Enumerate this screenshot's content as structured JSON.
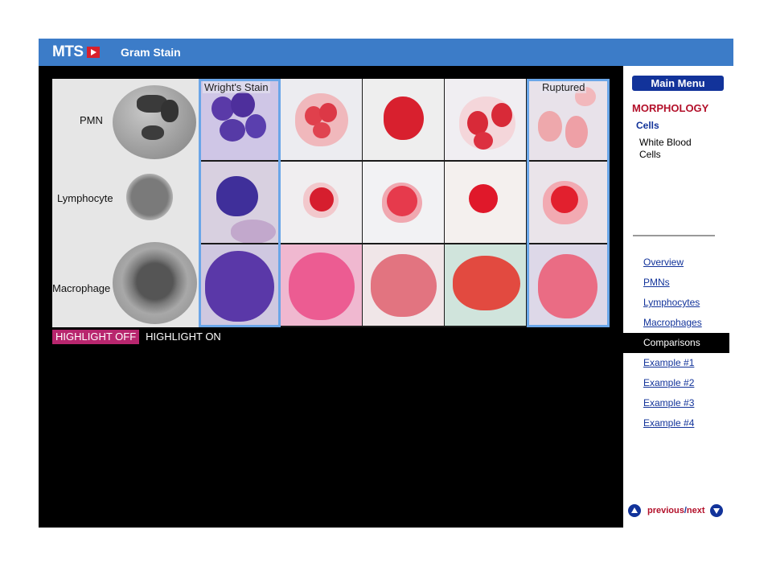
{
  "titlebar": {
    "logo": "MTS",
    "title": "Gram Stain"
  },
  "cell_types": [
    {
      "label": "PMN"
    },
    {
      "label": "Lymphocyte"
    },
    {
      "label": "Macrophage"
    }
  ],
  "columns": {
    "first": "Wright's Stain",
    "last": "Ruptured"
  },
  "highlight": {
    "off": "HIGHLIGHT OFF",
    "on": "HIGHLIGHT ON"
  },
  "sidebar": {
    "main_menu": "Main Menu",
    "section": "MORPHOLOGY",
    "subsection": "Cells",
    "subsubsection": "White Blood Cells",
    "nav": [
      {
        "label": "Overview",
        "active": false
      },
      {
        "label": "PMNs",
        "active": false
      },
      {
        "label": "Lymphocytes",
        "active": false
      },
      {
        "label": "Macrophages",
        "active": false
      },
      {
        "label": "Comparisons",
        "active": true
      },
      {
        "label": "Example #1",
        "active": false
      },
      {
        "label": "Example #2",
        "active": false
      },
      {
        "label": "Example #3",
        "active": false
      },
      {
        "label": "Example #4",
        "active": false
      }
    ],
    "pager": {
      "previous": "previous",
      "separator": "/",
      "next": "next"
    }
  },
  "colors": {
    "title_bar": "#3c7cc8",
    "accent_blue": "#12339a",
    "accent_red": "#b3102a",
    "highlight_magenta": "#b8266e",
    "frame_blue": "#6aa6e8"
  },
  "icons": {
    "logo": "play-arrow-icon",
    "pager_prev": "up-arrow-circle-icon",
    "pager_next": "down-arrow-circle-icon"
  }
}
